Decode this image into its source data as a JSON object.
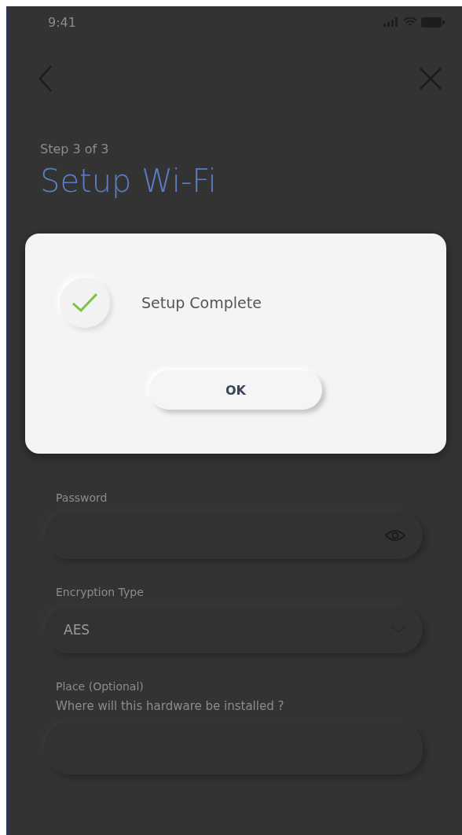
{
  "status_bar": {
    "time": "9:41"
  },
  "step": "Step 3 of 3",
  "title": "Setup Wi-Fi",
  "fields": [
    {
      "kind": "password",
      "label": "Password"
    },
    {
      "kind": "select",
      "label": "Encryption Type",
      "value": "AES"
    },
    {
      "kind": "text",
      "label": "Place (Optional)",
      "description": "Where will this hardware be installed ?"
    }
  ],
  "dialog": {
    "message": "Setup Complete",
    "button": "OK"
  }
}
